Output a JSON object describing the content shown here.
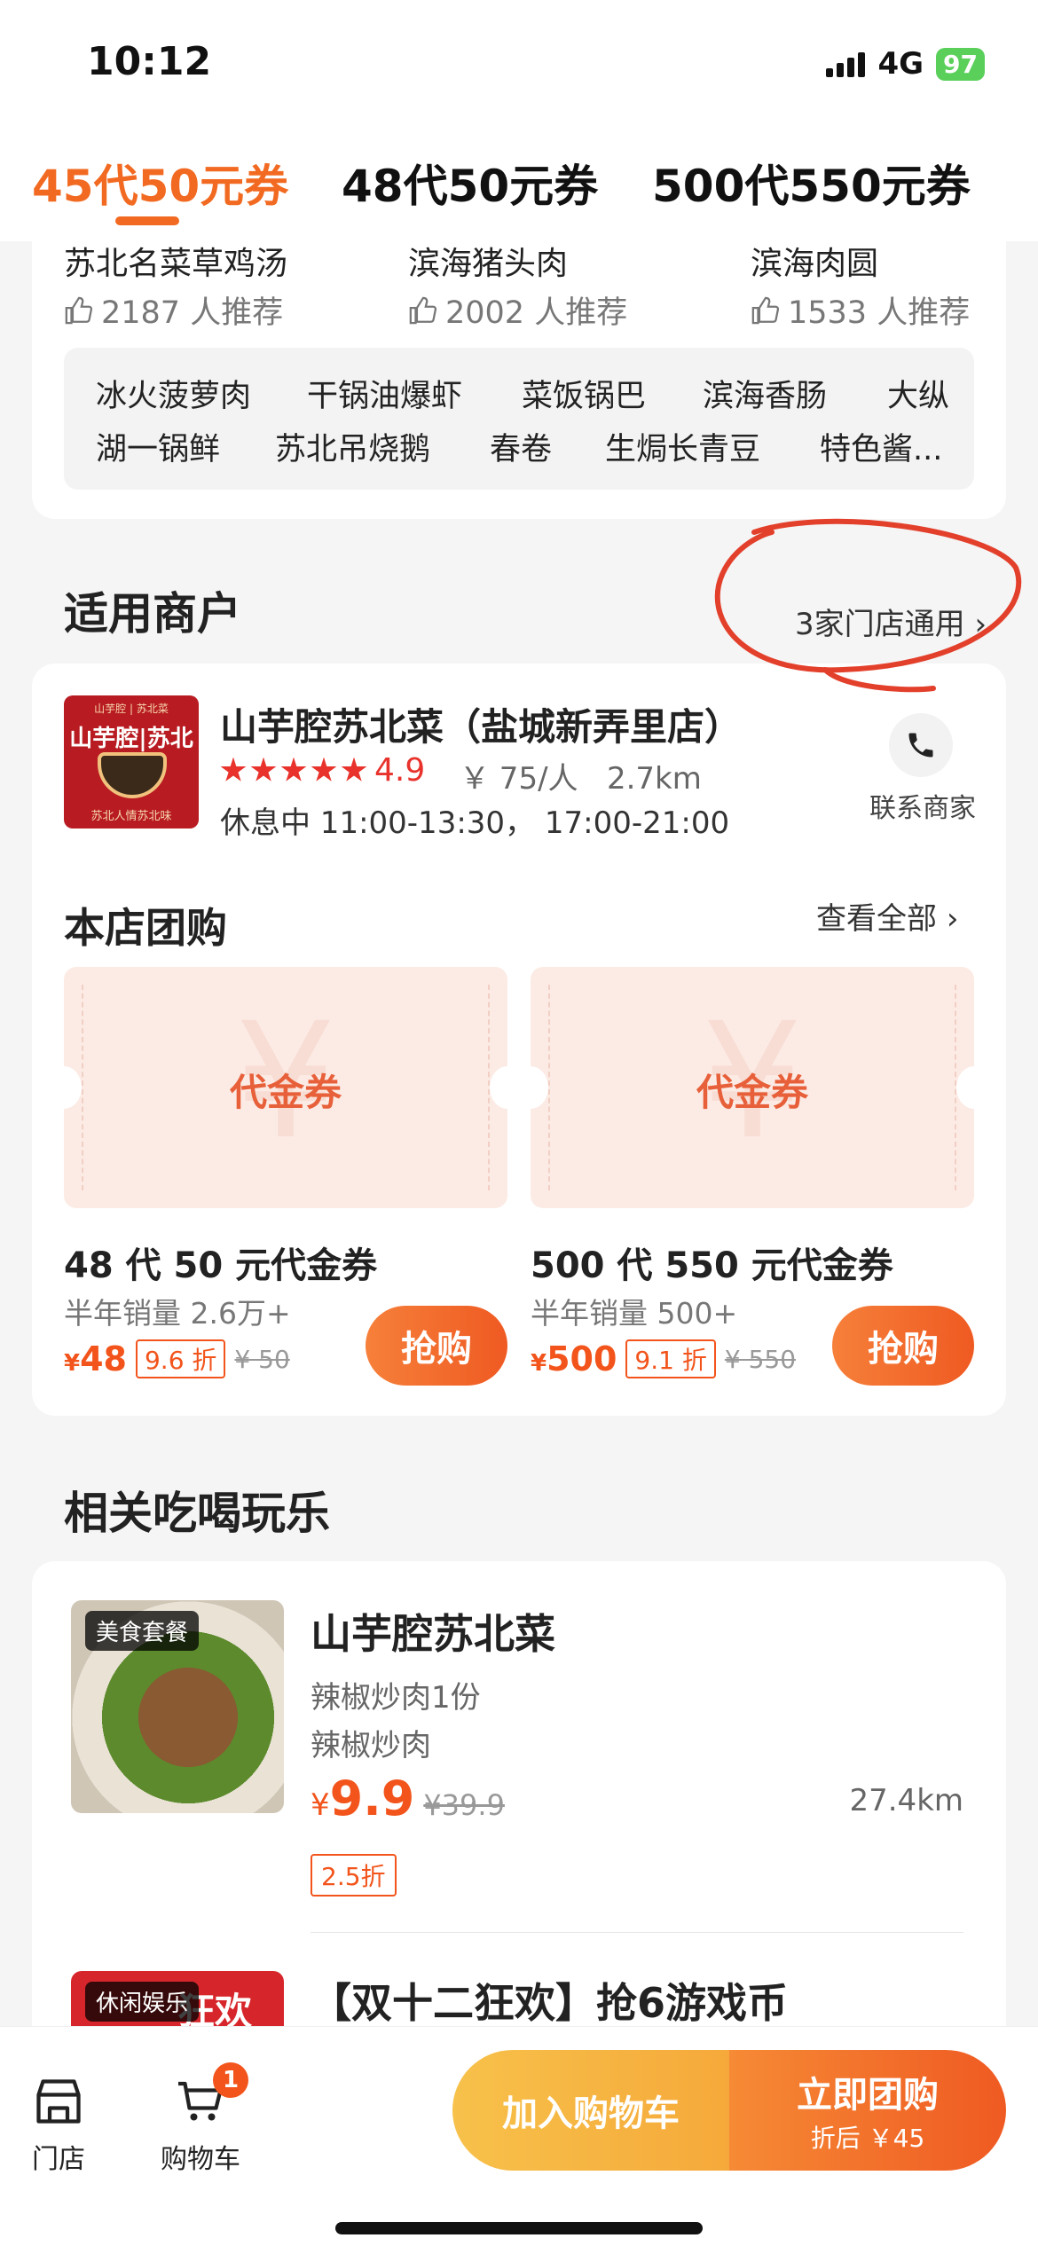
{
  "status": {
    "time": "10:12",
    "network": "4G",
    "battery": "97"
  },
  "tabs": [
    {
      "label": "45代50元券",
      "active": true
    },
    {
      "label": "48代50元券",
      "active": false
    },
    {
      "label": "500代550元券",
      "active": false
    }
  ],
  "dishes": [
    {
      "name": "苏北名菜草鸡汤",
      "recommend": "2187 人推荐"
    },
    {
      "name": "滨海猪头肉",
      "recommend": "2002 人推荐"
    },
    {
      "name": "滨海肉圆",
      "recommend": "1533 人推荐"
    }
  ],
  "dish_tags_row1": [
    "冰火菠萝肉",
    "干锅油爆虾",
    "菜饭锅巴",
    "滨海香肠",
    "大纵"
  ],
  "dish_tags_row2": [
    "湖一锅鲜",
    "苏北吊烧鹅",
    "春卷",
    "生焗长青豆",
    "特色酱..."
  ],
  "section_merchants": "适用商户",
  "stores_link": "3家门店通用",
  "merchant": {
    "name": "山芋腔苏北菜（盐城新弄里店）",
    "rating": "4.9",
    "price": "￥ 75/人",
    "distance": "2.7km",
    "hours": "休息中  11:00-13:30，  17:00-21:00",
    "contact_label": "联系商家",
    "logo_top": "山芋腔 | 苏北菜",
    "logo_name": "山芋腔|苏北菜",
    "logo_sub": "苏北人情苏北味"
  },
  "store_deals": {
    "title": "本店团购",
    "see_all": "查看全部",
    "items": [
      {
        "coupon_label": "代金券",
        "name": "48 代 50 元代金券",
        "sales": "半年销量 2.6万+",
        "currency": "¥",
        "price": "48",
        "discount": "9.6 折",
        "original": "¥ 50",
        "button": "抢购"
      },
      {
        "coupon_label": "代金券",
        "name": "500 代 550 元代金券",
        "sales": "半年销量 500+",
        "currency": "¥",
        "price": "500",
        "discount": "9.1 折",
        "original": "¥ 550",
        "button": "抢购"
      }
    ]
  },
  "related": {
    "title": "相关吃喝玩乐",
    "items": [
      {
        "tag": "美食套餐",
        "name": "山芋腔苏北菜",
        "line1": "辣椒炒肉1份",
        "line2": "辣椒炒肉",
        "currency": "¥",
        "price": "9.9",
        "original": "¥39.9",
        "distance": "27.4km",
        "discount": "2.5折"
      },
      {
        "tag": "休闲娱乐",
        "name": "【双十二狂欢】抢6游戏币",
        "image_text": "狂欢"
      }
    ]
  },
  "bottom_bar": {
    "store_label": "门店",
    "cart_label": "购物车",
    "cart_count": "1",
    "add_cart": "加入购物车",
    "buy_now": "立即团购",
    "buy_sub": "折后 ￥45"
  },
  "colors": {
    "accent": "#f26a21",
    "price": "#f2541b",
    "annotation": "#e3402c"
  }
}
